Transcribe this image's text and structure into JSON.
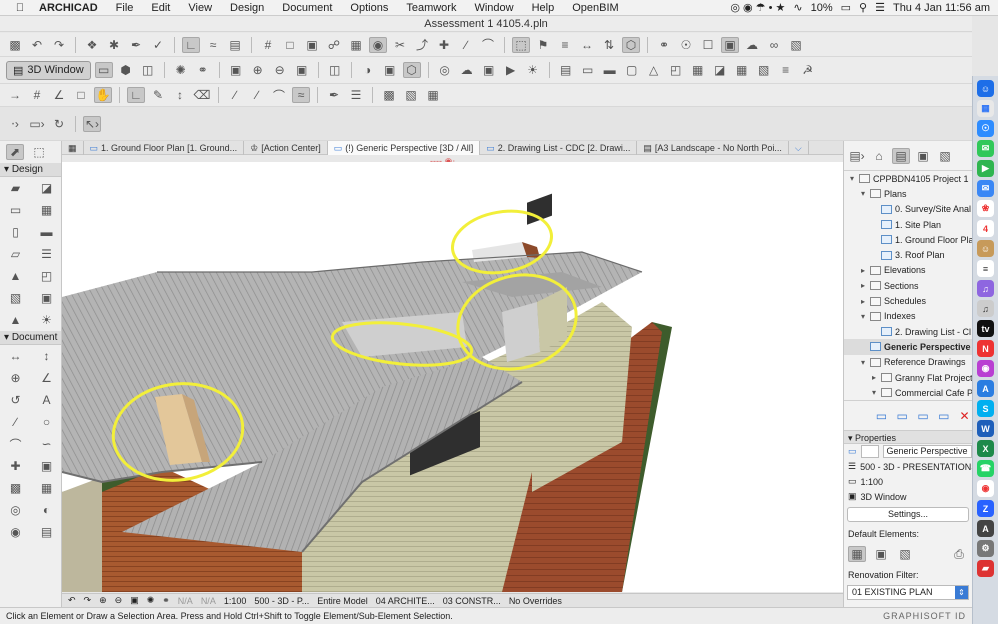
{
  "menubar": {
    "app": "ARCHICAD",
    "items": [
      "File",
      "Edit",
      "View",
      "Design",
      "Document",
      "Options",
      "Teamwork",
      "Window",
      "Help",
      "OpenBIM"
    ],
    "battery": "10%",
    "clock": "Thu 4 Jan  11:56 am"
  },
  "window": {
    "title": "Assessment 1 4105.4.pln"
  },
  "toolbar": {
    "view3d_label": "3D Window"
  },
  "toolbox": {
    "design_label": "Design",
    "document_label": "Document"
  },
  "tabs": [
    {
      "label": "1. Ground Floor Plan [1. Ground..."
    },
    {
      "label": "[Action Center]"
    },
    {
      "label": "(!) Generic Perspective [3D / All]"
    },
    {
      "label": "2. Drawing List - CDC [2. Drawi..."
    },
    {
      "label": "[A3 Landscape - No North Poi..."
    }
  ],
  "viewport_status": {
    "na1": "N/A",
    "na2": "N/A",
    "scale": "1:100",
    "layer_combo": "500 - 3D - P...",
    "model": "Entire Model",
    "pen_set": "04 ARCHITE...",
    "mvo": "03 CONSTR...",
    "overrides": "No Overrides"
  },
  "status_message": "Click an Element or Draw a Selection Area. Press and Hold Ctrl+Shift to Toggle Element/Sub-Element Selection.",
  "brand": "GRAPHISOFT ID",
  "navigator": {
    "tree": [
      {
        "label": "CPPBDN4105 Project 1",
        "level": 0,
        "type": "folder",
        "open": true
      },
      {
        "label": "Plans",
        "level": 1,
        "type": "folder",
        "open": true
      },
      {
        "label": "0. Survey/Site Anal",
        "level": 2,
        "type": "file"
      },
      {
        "label": "1. Site Plan",
        "level": 2,
        "type": "file"
      },
      {
        "label": "1. Ground Floor Pla",
        "level": 2,
        "type": "file"
      },
      {
        "label": "3. Roof Plan",
        "level": 2,
        "type": "file"
      },
      {
        "label": "Elevations",
        "level": 1,
        "type": "folder"
      },
      {
        "label": "Sections",
        "level": 1,
        "type": "folder"
      },
      {
        "label": "Schedules",
        "level": 1,
        "type": "folder"
      },
      {
        "label": "Indexes",
        "level": 1,
        "type": "folder",
        "open": true
      },
      {
        "label": "2. Drawing List - Cl",
        "level": 2,
        "type": "file"
      },
      {
        "label": "Generic Perspective",
        "level": 1,
        "type": "file",
        "selected": true
      },
      {
        "label": "Reference Drawings",
        "level": 1,
        "type": "folder",
        "open": true
      },
      {
        "label": "Granny Flat Project",
        "level": 2,
        "type": "folder"
      },
      {
        "label": "Commercial Cafe P",
        "level": 2,
        "type": "folder",
        "open": true
      }
    ]
  },
  "properties": {
    "header": "Properties",
    "name": "Generic Perspective",
    "layer": "500 - 3D - PRESENTATIONS",
    "scale": "1:100",
    "window": "3D Window",
    "settings_label": "Settings...",
    "default_elements_label": "Default Elements:",
    "renovation_label": "Renovation Filter:",
    "renovation_value": "01 EXISTING PLAN"
  },
  "colors": {
    "highlight_annotation": "#f2ef3a",
    "roof": "#a9a9a9",
    "wall": "#c8c6a4",
    "brick": "#9c4a2c",
    "grass": "#3e5c2c"
  }
}
